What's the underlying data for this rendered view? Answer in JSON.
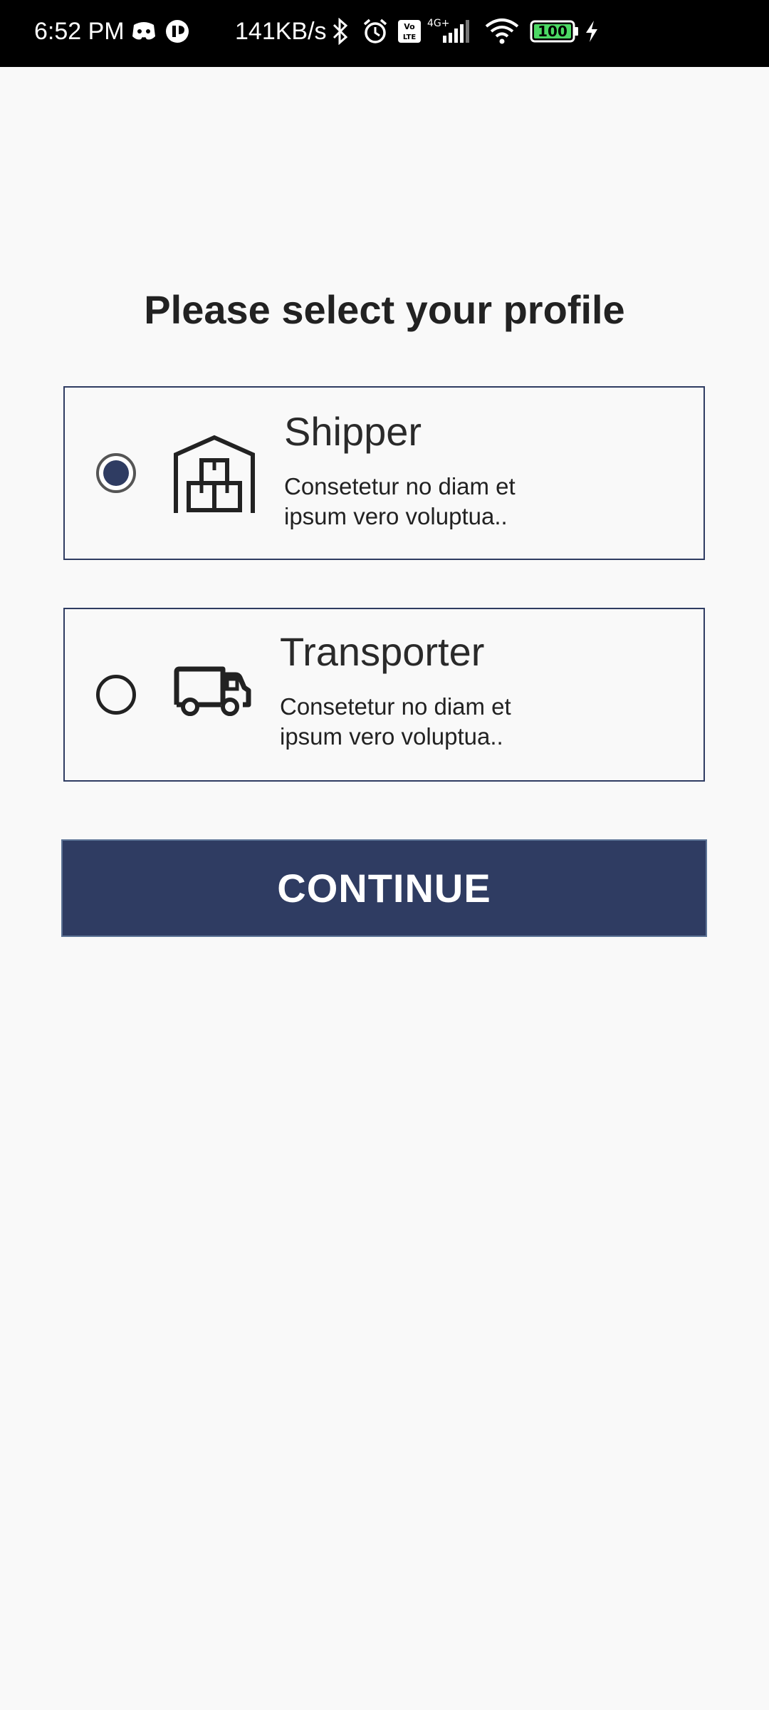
{
  "status_bar": {
    "time": "6:52 PM",
    "net_speed": "141KB/s",
    "network_type": "4G+",
    "volte": "Vo LTE",
    "battery": "100",
    "icons": [
      "discord-icon",
      "vpn-icon",
      "bluetooth-icon",
      "alarm-icon",
      "volte-icon",
      "signal-icon",
      "wifi-icon",
      "battery-icon",
      "charging-icon"
    ]
  },
  "page": {
    "title": "Please select your profile"
  },
  "profiles": [
    {
      "name": "Shipper",
      "description": "Consetetur no diam et ipsum vero voluptua..",
      "selected": true,
      "icon": "warehouse-icon"
    },
    {
      "name": "Transporter",
      "description": "Consetetur no diam et ipsum vero voluptua..",
      "selected": false,
      "icon": "truck-icon"
    }
  ],
  "continue_label": "CONTINUE",
  "colors": {
    "primary": "#2f3c62",
    "background": "#f9f9f9",
    "status_bar": "#000000",
    "text": "#222222"
  }
}
